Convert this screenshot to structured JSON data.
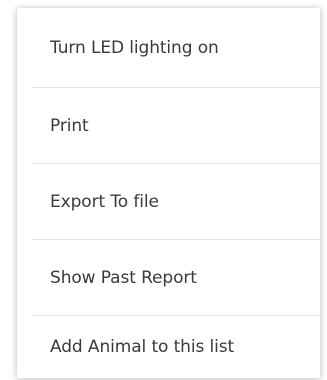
{
  "menu": {
    "items": [
      {
        "label": "Turn LED lighting on"
      },
      {
        "label": "Print"
      },
      {
        "label": "Export To file"
      },
      {
        "label": "Show Past Report"
      },
      {
        "label": "Add Animal to this list"
      }
    ]
  }
}
